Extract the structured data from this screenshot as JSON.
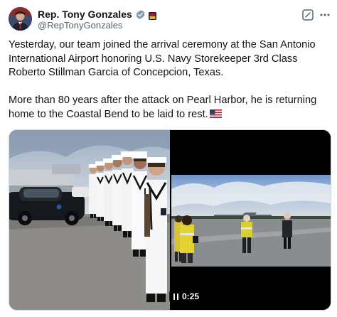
{
  "author": {
    "display_name": "Rep. Tony Gonzales",
    "handle": "@RepTonyGonzales"
  },
  "icons": {
    "verified": "verified-badge-icon",
    "affiliation": "affiliation-badge-icon",
    "grok": "grok-icon",
    "more": "more-options-icon",
    "flag": "us-flag-emoji"
  },
  "tweet": {
    "paragraph_1": "Yesterday, our team joined the arrival ceremony at the San Antonio International Airport honoring U.S. Navy Storekeeper 3rd Class Roberto Stillman Garcia of Concepcion, Texas.",
    "paragraph_2": "More than 80 years after the attack on Pearl Harbor, he is returning home to the Coastal Bend to be laid to rest."
  },
  "media": {
    "video_duration": "0:25"
  },
  "colors": {
    "verified_blue": "#1d9bf0",
    "secondary_text": "#536471",
    "primary_text": "#0f1419"
  }
}
